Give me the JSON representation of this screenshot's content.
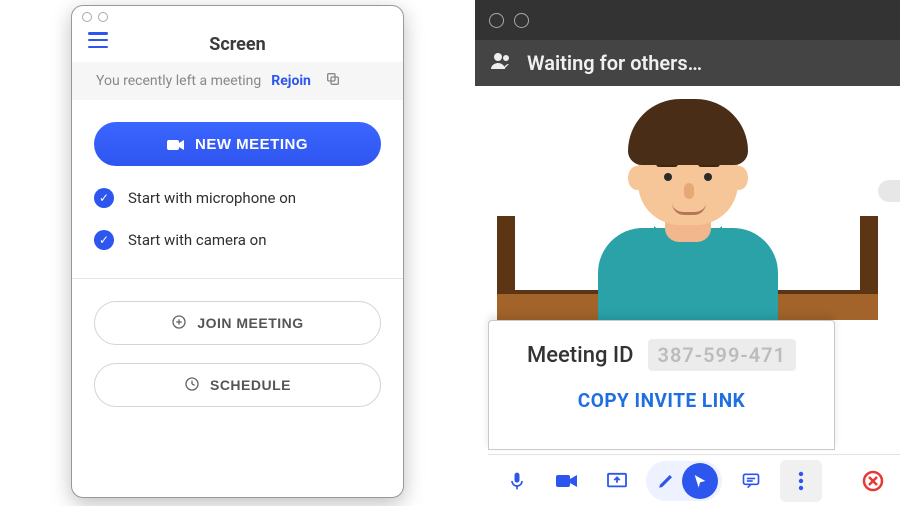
{
  "leftApp": {
    "title": "Screen",
    "banner": {
      "text": "You recently left a meeting",
      "rejoin": "Rejoin"
    },
    "newMeetingButton": "NEW MEETING",
    "option1": "Start with microphone on",
    "option2": "Start with camera on",
    "joinButton": "JOIN MEETING",
    "scheduleButton": "SCHEDULE"
  },
  "rightApp": {
    "waitingText": "Waiting for others…",
    "meetingIdLabel": "Meeting ID",
    "meetingId": "387-599-471",
    "copyInvite": "COPY INVITE LINK"
  }
}
